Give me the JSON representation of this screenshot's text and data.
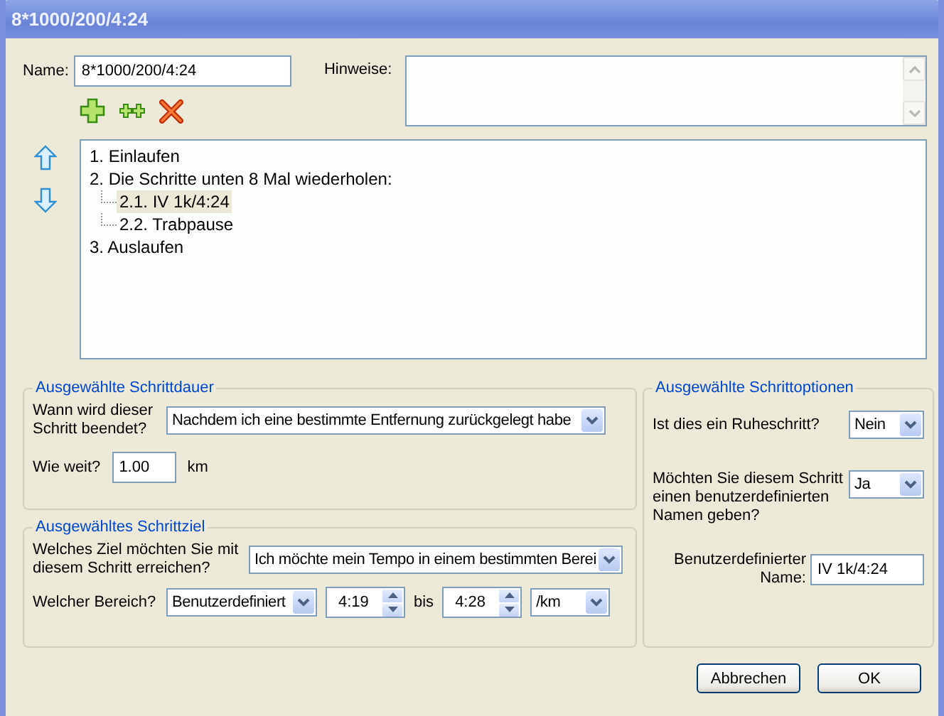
{
  "window": {
    "title": "8*1000/200/4:24"
  },
  "name": {
    "label": "Name:",
    "value": "8*1000/200/4:24"
  },
  "notes": {
    "label": "Hinweise:"
  },
  "steps": [
    {
      "label": "1. Einlaufen",
      "selected": false
    },
    {
      "label": "2. Die Schritte unten 8 Mal wiederholen:",
      "selected": false,
      "children": [
        {
          "label": "2.1. IV 1k/4:24",
          "selected": true
        },
        {
          "label": "2.2. Trabpause",
          "selected": false
        }
      ]
    },
    {
      "label": "3. Auslaufen",
      "selected": false
    }
  ],
  "duration": {
    "title": "Ausgewählte Schrittdauer",
    "end_label": "Wann wird dieser Schritt beendet?",
    "end_value": "Nachdem ich eine bestimmte Entfernung zurückgelegt habe",
    "distance_label": "Wie weit?",
    "distance_value": "1.00",
    "distance_unit": "km"
  },
  "target": {
    "title": "Ausgewähltes Schrittziel",
    "goal_label": "Welches Ziel möchten Sie mit diesem Schritt erreichen?",
    "goal_value": "Ich möchte mein Tempo in einem bestimmten Berei",
    "range_label": "Welcher Bereich?",
    "range_value": "Benutzerdefiniert",
    "from": "4:19",
    "to_label": "bis",
    "to": "4:28",
    "unit": "/km"
  },
  "options": {
    "title": "Ausgewählte Schrittoptionen",
    "rest_label": "Ist dies ein Ruheschritt?",
    "rest_value": "Nein",
    "custom_label": "Möchten Sie diesem Schritt einen benutzerdefinierten Namen geben?",
    "custom_value": "Ja",
    "custom_name_label": "Benutzerdefinierter Name:",
    "custom_name_value": "IV 1k/4:24"
  },
  "buttons": [
    "Abbrechen",
    "OK"
  ]
}
